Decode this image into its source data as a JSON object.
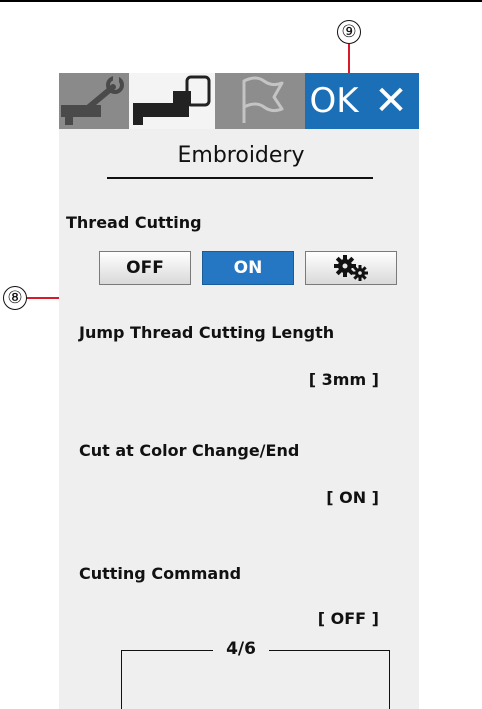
{
  "callouts": {
    "nine": "⑨",
    "eight": "⑧"
  },
  "tabs": {
    "ok": "OK",
    "close": "✕"
  },
  "title": "Embroidery",
  "thread_cutting": {
    "label": "Thread Cutting",
    "off": "OFF",
    "on": "ON",
    "selected": "ON"
  },
  "settings": [
    {
      "label": "Jump Thread Cutting Length",
      "value": "[ 3mm ]"
    },
    {
      "label": "Cut at Color Change/End",
      "value": "[ ON ]"
    },
    {
      "label": "Cutting Command",
      "value": "[ OFF ]"
    }
  ],
  "pager": "4/6",
  "colors": {
    "accent": "#1b6fb6",
    "tab_bar": "#6b6b6b",
    "leader": "#d81b2b",
    "screen_bg": "#efefef"
  },
  "icons": [
    "wrench-icon",
    "sewing-machine-icon",
    "embroidery-machine-icon",
    "flag-icon",
    "close-icon",
    "gears-icon"
  ]
}
